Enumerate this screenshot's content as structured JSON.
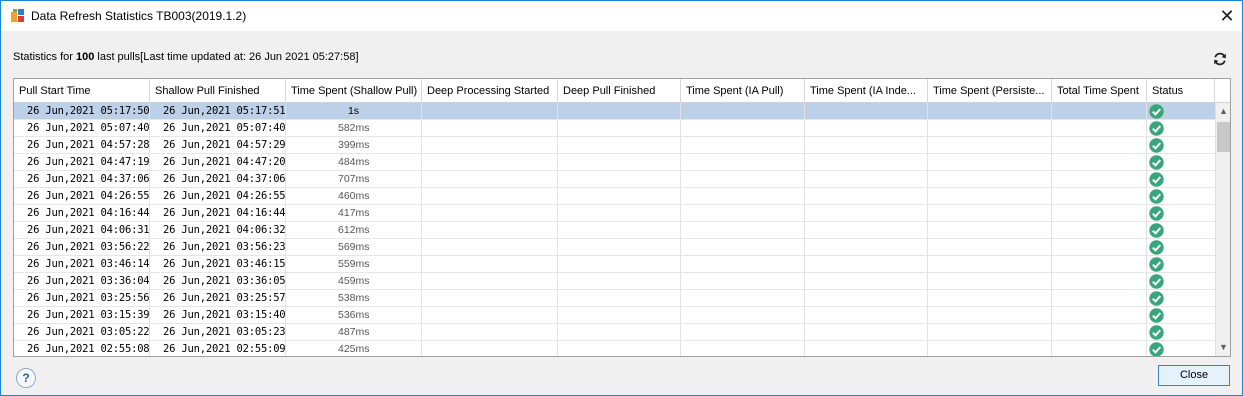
{
  "window": {
    "title": "Data Refresh Statistics TB003(2019.1.2)",
    "close_glyph": "✕"
  },
  "stats": {
    "prefix": "Statistics for ",
    "count": "100",
    "suffix": " last pulls[Last time updated at: 26 Jun 2021  05:27:58]"
  },
  "table": {
    "columns": [
      "Pull Start Time",
      "Shallow Pull Finished",
      "Time Spent (Shallow Pull)",
      "Deep Processing Started",
      "Deep Pull Finished",
      "Time Spent (IA Pull)",
      "Time Spent (IA Inde...",
      "Time Spent (Persiste...",
      "Total Time Spent",
      "Status"
    ],
    "rows": [
      {
        "start": "26 Jun,2021 05:17:50",
        "shallow": "26 Jun,2021 05:17:51",
        "spent": "1s",
        "status": "success",
        "selected": true
      },
      {
        "start": "26 Jun,2021 05:07:40",
        "shallow": "26 Jun,2021 05:07:40",
        "spent": "582ms",
        "status": "success"
      },
      {
        "start": "26 Jun,2021 04:57:28",
        "shallow": "26 Jun,2021 04:57:29",
        "spent": "399ms",
        "status": "success"
      },
      {
        "start": "26 Jun,2021 04:47:19",
        "shallow": "26 Jun,2021 04:47:20",
        "spent": "484ms",
        "status": "success"
      },
      {
        "start": "26 Jun,2021 04:37:06",
        "shallow": "26 Jun,2021 04:37:06",
        "spent": "707ms",
        "status": "success"
      },
      {
        "start": "26 Jun,2021 04:26:55",
        "shallow": "26 Jun,2021 04:26:55",
        "spent": "460ms",
        "status": "success"
      },
      {
        "start": "26 Jun,2021 04:16:44",
        "shallow": "26 Jun,2021 04:16:44",
        "spent": "417ms",
        "status": "success"
      },
      {
        "start": "26 Jun,2021 04:06:31",
        "shallow": "26 Jun,2021 04:06:32",
        "spent": "612ms",
        "status": "success"
      },
      {
        "start": "26 Jun,2021 03:56:22",
        "shallow": "26 Jun,2021 03:56:23",
        "spent": "569ms",
        "status": "success"
      },
      {
        "start": "26 Jun,2021 03:46:14",
        "shallow": "26 Jun,2021 03:46:15",
        "spent": "559ms",
        "status": "success"
      },
      {
        "start": "26 Jun,2021 03:36:04",
        "shallow": "26 Jun,2021 03:36:05",
        "spent": "459ms",
        "status": "success"
      },
      {
        "start": "26 Jun,2021 03:25:56",
        "shallow": "26 Jun,2021 03:25:57",
        "spent": "538ms",
        "status": "success"
      },
      {
        "start": "26 Jun,2021 03:15:39",
        "shallow": "26 Jun,2021 03:15:40",
        "spent": "536ms",
        "status": "success"
      },
      {
        "start": "26 Jun,2021 03:05:22",
        "shallow": "26 Jun,2021 03:05:23",
        "spent": "487ms",
        "status": "success"
      },
      {
        "start": "26 Jun,2021 02:55:08",
        "shallow": "26 Jun,2021 02:55:09",
        "spent": "425ms",
        "status": "success"
      }
    ]
  },
  "footer": {
    "help_label": "?",
    "close_label": "Close"
  },
  "colors": {
    "selection": "#bcd0e8",
    "status_ok": "#3aa57a",
    "window_border": "#1883d7"
  },
  "icons": {
    "app": "app-logo-icon",
    "refresh": "refresh-icon",
    "status": "check-circle-icon",
    "help": "help-icon"
  }
}
